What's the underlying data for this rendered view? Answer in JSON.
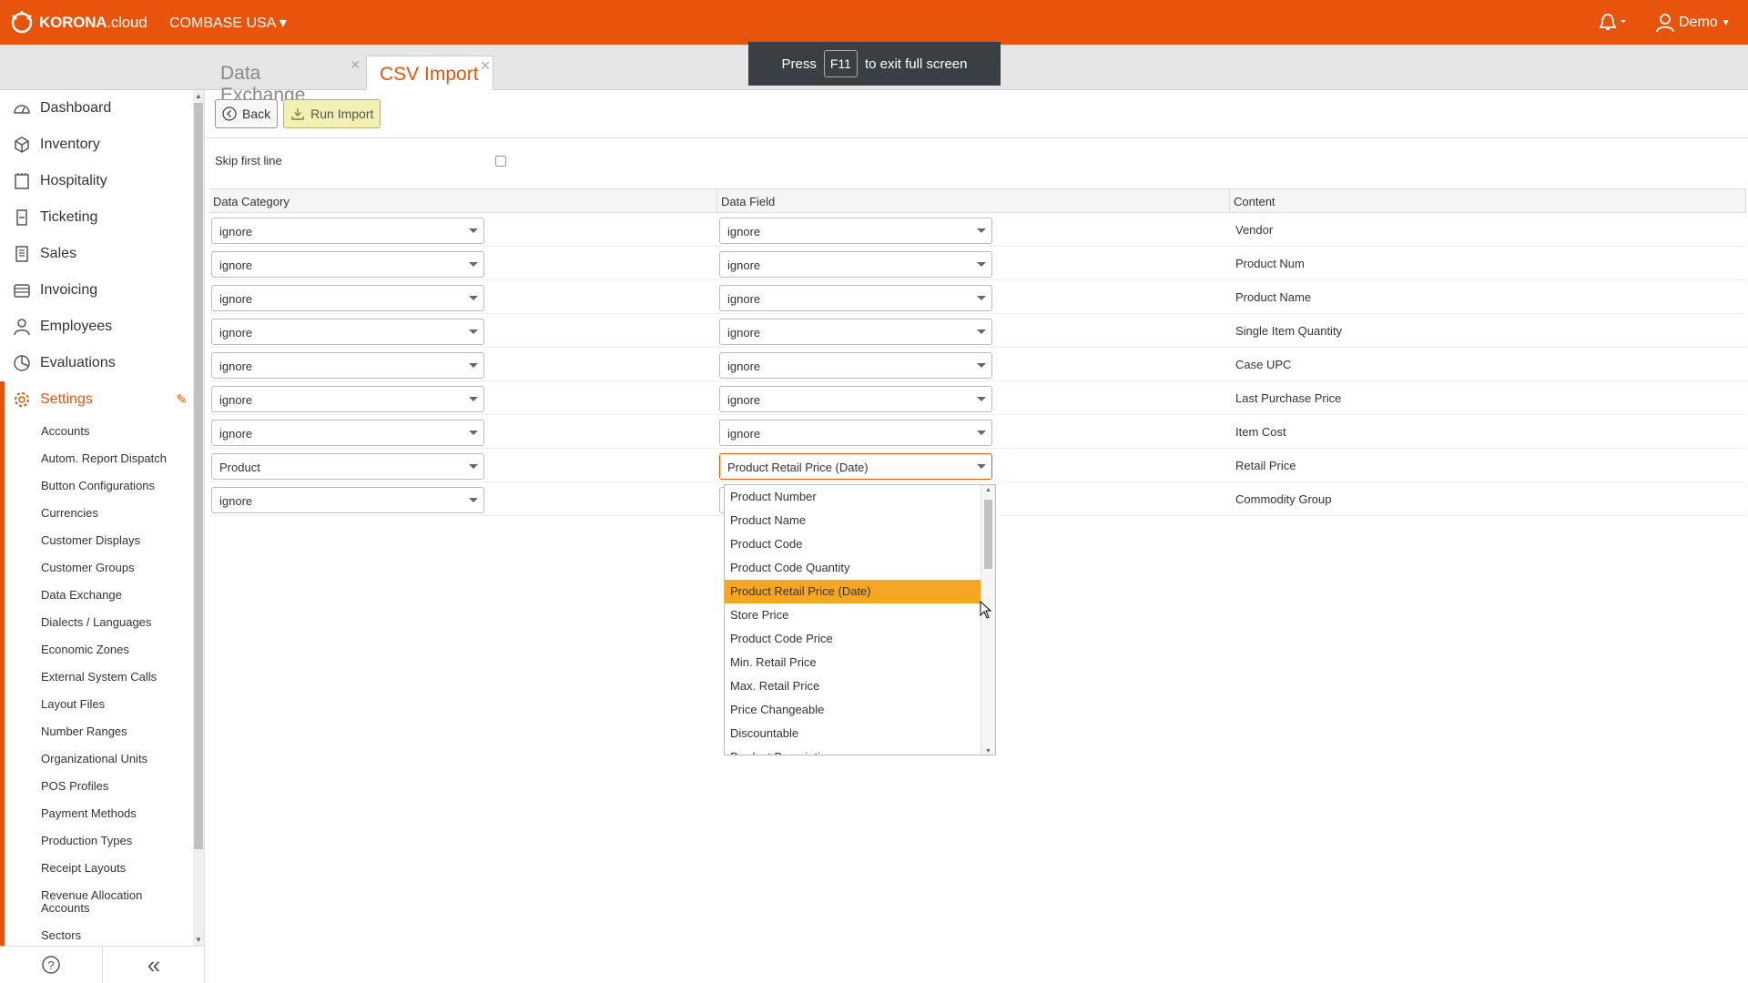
{
  "header": {
    "logo_bold": "KORONA",
    "logo_light": ".cloud",
    "company": "COMBASE USA ▾",
    "user": "Demo",
    "brand_color": "#e8540c"
  },
  "tabs": [
    {
      "label": "Data Exchange",
      "active": false
    },
    {
      "label": "CSV Import",
      "active": true
    }
  ],
  "fullscreen_tip": {
    "before": "Press",
    "key": "F11",
    "after": "to exit full screen"
  },
  "sidebar": {
    "items": [
      {
        "label": "Dashboard",
        "icon": "dashboard-icon"
      },
      {
        "label": "Inventory",
        "icon": "box-icon"
      },
      {
        "label": "Hospitality",
        "icon": "hospitality-icon"
      },
      {
        "label": "Ticketing",
        "icon": "ticket-icon"
      },
      {
        "label": "Sales",
        "icon": "receipt-icon"
      },
      {
        "label": "Invoicing",
        "icon": "invoice-icon"
      },
      {
        "label": "Employees",
        "icon": "person-icon"
      },
      {
        "label": "Evaluations",
        "icon": "pie-chart-icon"
      },
      {
        "label": "Settings",
        "icon": "gear-icon"
      }
    ],
    "sub_items": [
      "Accounts",
      "Autom. Report Dispatch",
      "Button Configurations",
      "Currencies",
      "Customer Displays",
      "Customer Groups",
      "Data Exchange",
      "Dialects / Languages",
      "Economic Zones",
      "External System Calls",
      "Layout Files",
      "Number Ranges",
      "Organizational Units",
      "POS Profiles",
      "Payment Methods",
      "Production Types",
      "Receipt Layouts",
      "Revenue Allocation Accounts",
      "Sectors"
    ],
    "footer_help": "?",
    "footer_collapse": "«"
  },
  "toolbar": {
    "back_label": "Back",
    "run_label": "Run Import"
  },
  "skip_first_line": {
    "label": "Skip first line",
    "checked": false
  },
  "grid": {
    "headers": [
      "Data Category",
      "Data Field",
      "Content"
    ],
    "rows": [
      {
        "category": "ignore",
        "field": "ignore",
        "content": "Vendor"
      },
      {
        "category": "ignore",
        "field": "ignore",
        "content": "Product Num"
      },
      {
        "category": "ignore",
        "field": "ignore",
        "content": "Product Name"
      },
      {
        "category": "ignore",
        "field": "ignore",
        "content": "Single Item Quantity"
      },
      {
        "category": "ignore",
        "field": "ignore",
        "content": "Case UPC"
      },
      {
        "category": "ignore",
        "field": "ignore",
        "content": "Last Purchase Price"
      },
      {
        "category": "ignore",
        "field": "ignore",
        "content": "Item Cost"
      },
      {
        "category": "Product",
        "field": "Product Retail Price (Date)",
        "content": "Retail Price"
      },
      {
        "category": "ignore",
        "field": "",
        "content": "Commodity Group"
      }
    ]
  },
  "dropdown": {
    "options": [
      "Product Number",
      "Product Name",
      "Product Code",
      "Product Code Quantity",
      "Product Retail Price (Date)",
      "Store Price",
      "Product Code Price",
      "Min. Retail Price",
      "Max. Retail Price",
      "Price Changeable",
      "Discountable",
      "Product Description"
    ],
    "selected": "Product Retail Price (Date)",
    "highlight_color": "#f5a623"
  }
}
